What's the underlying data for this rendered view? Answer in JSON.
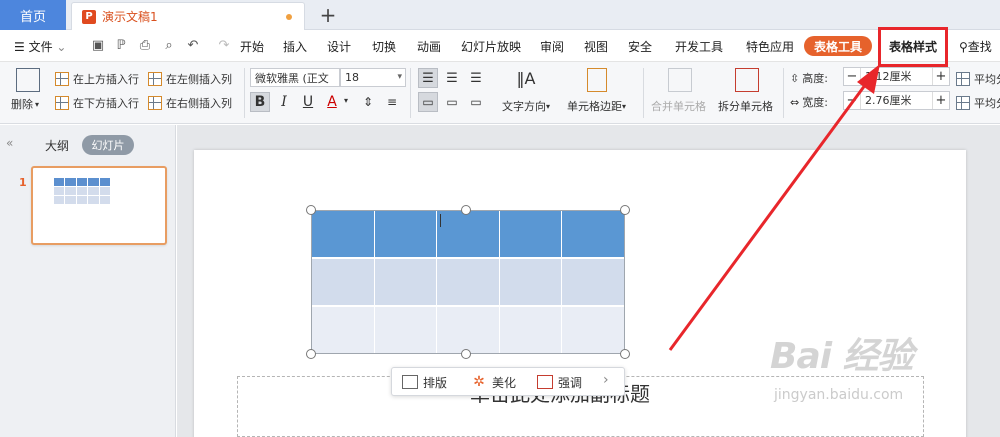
{
  "tabs": {
    "home": "首页",
    "doc_icon_letter": "P",
    "doc": "演示文稿1",
    "add": "+"
  },
  "menu": {
    "file": "文件",
    "items": [
      "开始",
      "插入",
      "设计",
      "切换",
      "动画",
      "幻灯片放映",
      "审阅",
      "视图",
      "安全",
      "开发工具",
      "特色应用"
    ],
    "table_tools": "表格工具",
    "table_style": "表格样式",
    "search": "查找"
  },
  "ribbon": {
    "delete": "删除",
    "insert_above": "在上方插入行",
    "insert_below": "在下方插入行",
    "insert_left": "在左侧插入列",
    "insert_right": "在右侧插入列",
    "font_name": "微软雅黑 (正文",
    "font_size": "18",
    "bold": "B",
    "italic": "I",
    "underline": "U",
    "font_color": "A",
    "text_direction": "文字方向",
    "cell_margin": "单元格边距",
    "merge_cells": "合并单元格",
    "split_cells": "拆分单元格",
    "height_label": "高度:",
    "height_value": "1.12厘米",
    "width_label": "宽度:",
    "width_value": "2.76厘米",
    "distribute_rows": "平均分",
    "distribute_cols": "平均分"
  },
  "sidebar": {
    "outline": "大纲",
    "slides": "幻灯片",
    "slide_number": "1"
  },
  "slide": {
    "subtitle": "单击此处添加副标题"
  },
  "float_toolbar": {
    "layout": "排版",
    "beautify": "美化",
    "emphasize": "强调"
  },
  "watermark": {
    "brand": "Bai 经验",
    "url": "jingyan.baidu.com"
  },
  "colors": {
    "accent": "#e6622c",
    "home_tab": "#4d86dd",
    "table_header": "#5a97d3",
    "annotation": "#e8262b"
  }
}
